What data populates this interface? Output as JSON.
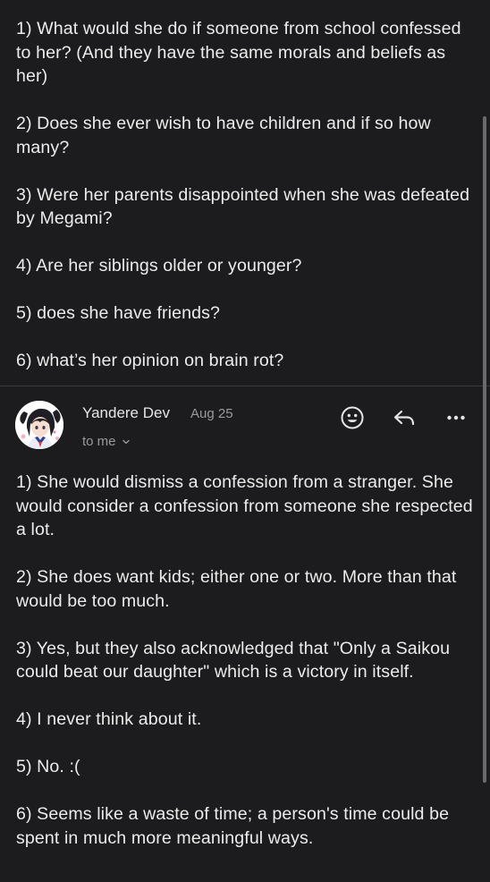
{
  "quoted_message": {
    "paragraphs": [
      "1) What would she do if someone from school confessed to her? (And they have the same morals and beliefs as her)",
      "2) Does she ever wish to have children and if so how many?",
      "3) Were her parents disappointed when she was defeated by Megami?",
      "4) Are her siblings older or younger?",
      "5) does she have friends?",
      "6) what’s her opinion on brain rot?"
    ]
  },
  "reply_header": {
    "sender_name": "Yandere Dev",
    "date": "Aug 25",
    "recipient": "to me",
    "icons": {
      "emoji": "smiley-face-icon",
      "reply": "reply-arrow-icon",
      "more": "more-dots-icon",
      "expand": "chevron-down-icon"
    }
  },
  "reply_message": {
    "paragraphs": [
      "1) She would dismiss a confession from a stranger. She would consider a confession from someone she respected a lot.",
      "2) She does want kids; either one or two. More than that would be too much.",
      "3) Yes, but they also acknowledged that \"Only a Saikou could beat our daughter\" which is a victory in itself.",
      "4) I never think about it.",
      "5) No. :(",
      "6) Seems like a waste of time; a person's time could be spent in much more meaningful ways."
    ]
  },
  "colors": {
    "background": "#1c1c1e",
    "text": "#ececec",
    "secondary_text": "#9a9a9e",
    "divider": "#3a3a3c"
  }
}
